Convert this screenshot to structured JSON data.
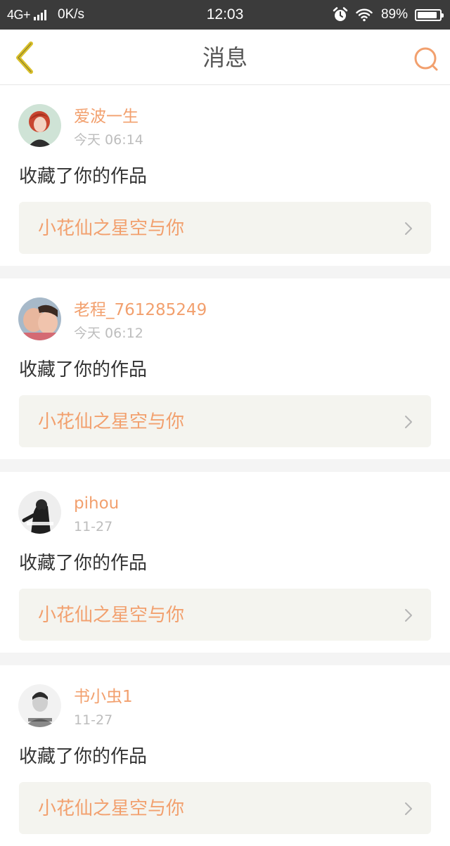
{
  "status_bar": {
    "network": "4G+",
    "speed": "0K/s",
    "time": "12:03",
    "battery_text": "89%",
    "battery_level": 0.89
  },
  "nav": {
    "title": "消息",
    "back_icon": "chevron-left-icon",
    "search_icon": "search-icon"
  },
  "colors": {
    "accent": "#f2a06e",
    "back_icon": "#d9c02a",
    "status_bar_bg": "#3b3b3b",
    "link_bg": "#f4f4ef",
    "gap_bg": "#f4f4f4"
  },
  "messages": [
    {
      "username": "爱波一生",
      "time": "今天 06:14",
      "action": "收藏了你的作品",
      "work_title": "小花仙之星空与你"
    },
    {
      "username": "老程_761285249",
      "time": "今天 06:12",
      "action": "收藏了你的作品",
      "work_title": "小花仙之星空与你"
    },
    {
      "username": "pihou",
      "time": "11-27",
      "action": "收藏了你的作品",
      "work_title": "小花仙之星空与你"
    },
    {
      "username": "书小虫1",
      "time": "11-27",
      "action": "收藏了你的作品",
      "work_title": "小花仙之星空与你"
    }
  ]
}
